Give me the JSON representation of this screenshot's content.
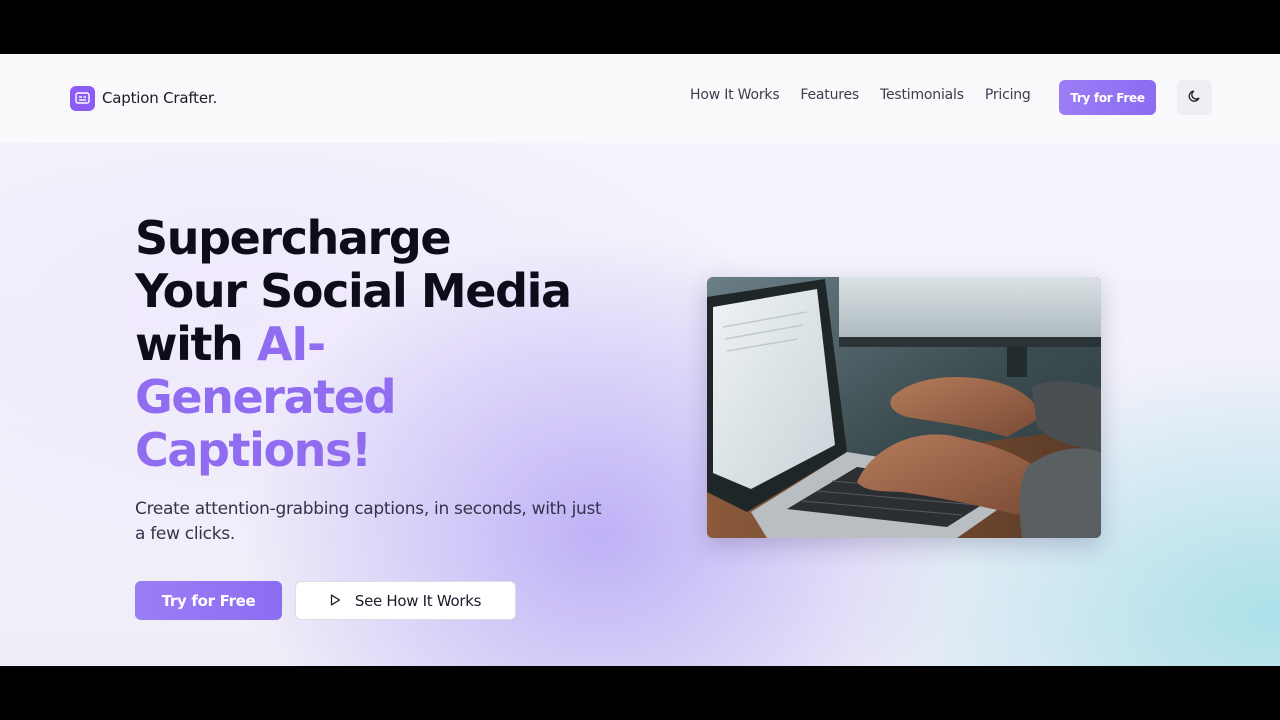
{
  "brand": {
    "name": "Caption Crafter.",
    "icon": "caption-icon",
    "color": "#8b5cf6"
  },
  "nav": {
    "links": [
      "How It Works",
      "Features",
      "Testimonials",
      "Pricing"
    ],
    "cta": "Try for Free",
    "theme_toggle_icon": "moon-icon"
  },
  "hero": {
    "title_line1": "Supercharge",
    "title_line2": "Your Social Media",
    "title_with": "with ",
    "title_accent_line1": "AI-",
    "title_accent_line2": "Generated",
    "title_accent_line3": "Captions!",
    "subtitle": "Create attention-grabbing captions, in seconds, with just a few clicks.",
    "primary_button": "Try for Free",
    "secondary_button": "See How It Works",
    "secondary_icon": "play-icon",
    "image": "laptop-typing-photo"
  },
  "colors": {
    "accent": "#8f6cf0",
    "text": "#0d0d1a"
  }
}
